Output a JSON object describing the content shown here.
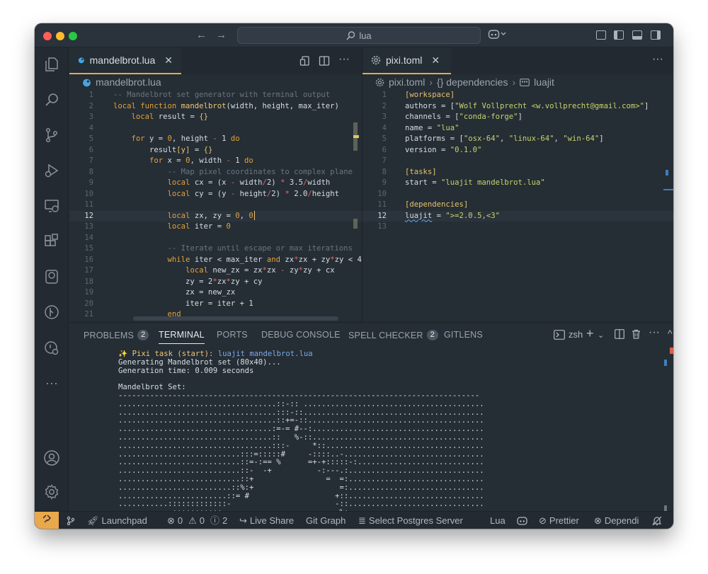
{
  "titlebar": {
    "search_text": "lua",
    "back_icon": "←",
    "forward_icon": "→"
  },
  "activity_bar": {
    "items": [
      "explorer-icon",
      "search-icon",
      "source-control-icon",
      "run-debug-icon",
      "remote-explorer-icon",
      "extensions-icon",
      "database-icon",
      "git-graph-icon",
      "timeline-icon",
      "more-icon"
    ],
    "bottom": [
      "account-icon",
      "settings-icon"
    ]
  },
  "editor_left": {
    "tab_label": "mandelbrot.lua",
    "breadcrumb": "mandelbrot.lua",
    "current_line": "12",
    "lines": [
      {
        "n": "1",
        "tokens": [
          [
            "c",
            "-- Mandelbrot set generator with terminal output"
          ]
        ]
      },
      {
        "n": "2",
        "tokens": [
          [
            "k",
            "local function "
          ],
          [
            "f",
            "mandelbrot"
          ],
          [
            "p",
            "(width, height, max_iter)"
          ]
        ]
      },
      {
        "n": "3",
        "tokens": [
          [
            "p",
            "    "
          ],
          [
            "k",
            "local "
          ],
          [
            "p",
            "result = "
          ],
          [
            "b",
            "{}"
          ]
        ]
      },
      {
        "n": "4",
        "tokens": []
      },
      {
        "n": "5",
        "tokens": [
          [
            "p",
            "    "
          ],
          [
            "k",
            "for "
          ],
          [
            "p",
            "y = "
          ],
          [
            "n",
            "0"
          ],
          [
            "p",
            ", height "
          ],
          [
            "o",
            "-"
          ],
          [
            "p",
            " 1 "
          ],
          [
            "k",
            "do"
          ]
        ]
      },
      {
        "n": "6",
        "tokens": [
          [
            "p",
            "        result"
          ],
          [
            "b",
            "[y]"
          ],
          [
            "p",
            " = "
          ],
          [
            "b",
            "{}"
          ]
        ]
      },
      {
        "n": "7",
        "tokens": [
          [
            "p",
            "        "
          ],
          [
            "k",
            "for "
          ],
          [
            "p",
            "x = "
          ],
          [
            "n",
            "0"
          ],
          [
            "p",
            ", width "
          ],
          [
            "o",
            "-"
          ],
          [
            "p",
            " 1 "
          ],
          [
            "k",
            "do"
          ]
        ]
      },
      {
        "n": "8",
        "tokens": [
          [
            "p",
            "            "
          ],
          [
            "c",
            "-- Map pixel coordinates to complex plane"
          ]
        ]
      },
      {
        "n": "9",
        "tokens": [
          [
            "p",
            "            "
          ],
          [
            "k",
            "local "
          ],
          [
            "p",
            "cx = (x "
          ],
          [
            "o",
            "-"
          ],
          [
            "p",
            " width"
          ],
          [
            "o",
            "/"
          ],
          [
            "p",
            "2) "
          ],
          [
            "o",
            "*"
          ],
          [
            "p",
            " 3.5"
          ],
          [
            "o",
            "/"
          ],
          [
            "p",
            "width"
          ]
        ]
      },
      {
        "n": "10",
        "tokens": [
          [
            "p",
            "            "
          ],
          [
            "k",
            "local "
          ],
          [
            "p",
            "cy = (y "
          ],
          [
            "o",
            "-"
          ],
          [
            "p",
            " height"
          ],
          [
            "o",
            "/"
          ],
          [
            "p",
            "2) "
          ],
          [
            "o",
            "*"
          ],
          [
            "p",
            " 2.0"
          ],
          [
            "o",
            "/"
          ],
          [
            "p",
            "height"
          ]
        ]
      },
      {
        "n": "11",
        "tokens": []
      },
      {
        "n": "12",
        "tokens": [
          [
            "p",
            "            "
          ],
          [
            "k",
            "local "
          ],
          [
            "p",
            "zx, zy = "
          ],
          [
            "n",
            "0"
          ],
          [
            "p",
            ", "
          ],
          [
            "n",
            "0"
          ]
        ]
      },
      {
        "n": "13",
        "tokens": [
          [
            "p",
            "            "
          ],
          [
            "k",
            "local "
          ],
          [
            "p",
            "iter = "
          ],
          [
            "n",
            "0"
          ]
        ]
      },
      {
        "n": "14",
        "tokens": []
      },
      {
        "n": "15",
        "tokens": [
          [
            "p",
            "            "
          ],
          [
            "c",
            "-- Iterate until escape or max iterations"
          ]
        ]
      },
      {
        "n": "16",
        "tokens": [
          [
            "p",
            "            "
          ],
          [
            "k",
            "while "
          ],
          [
            "p",
            "iter < max_iter "
          ],
          [
            "k",
            "and "
          ],
          [
            "p",
            "zx"
          ],
          [
            "o",
            "*"
          ],
          [
            "p",
            "zx + zy"
          ],
          [
            "o",
            "*"
          ],
          [
            "p",
            "zy < 4 "
          ],
          [
            "k",
            "d"
          ]
        ]
      },
      {
        "n": "17",
        "tokens": [
          [
            "p",
            "                "
          ],
          [
            "k",
            "local "
          ],
          [
            "p",
            "new_zx = zx"
          ],
          [
            "o",
            "*"
          ],
          [
            "p",
            "zx "
          ],
          [
            "o",
            "-"
          ],
          [
            "p",
            " zy"
          ],
          [
            "o",
            "*"
          ],
          [
            "p",
            "zy + cx"
          ]
        ]
      },
      {
        "n": "18",
        "tokens": [
          [
            "p",
            "                zy = 2"
          ],
          [
            "o",
            "*"
          ],
          [
            "p",
            "zx"
          ],
          [
            "o",
            "*"
          ],
          [
            "p",
            "zy + cy"
          ]
        ]
      },
      {
        "n": "19",
        "tokens": [
          [
            "p",
            "                zx = new_zx"
          ]
        ]
      },
      {
        "n": "20",
        "tokens": [
          [
            "p",
            "                iter = iter + 1"
          ]
        ]
      },
      {
        "n": "21",
        "tokens": [
          [
            "p",
            "            "
          ],
          [
            "k",
            "end"
          ]
        ]
      }
    ]
  },
  "editor_right": {
    "tab_label": "pixi.toml",
    "breadcrumb": [
      "pixi.toml",
      "{} dependencies",
      "luajit"
    ],
    "current_line": "12",
    "lines": [
      {
        "n": "1",
        "tokens": [
          [
            "t",
            "[workspace]"
          ]
        ]
      },
      {
        "n": "2",
        "tokens": [
          [
            "p",
            "authors = ["
          ],
          [
            "s",
            "\"Wolf Vollprecht <w.vollprecht@gmail.com>\""
          ],
          [
            "p",
            "]"
          ]
        ]
      },
      {
        "n": "3",
        "tokens": [
          [
            "p",
            "channels = ["
          ],
          [
            "s",
            "\"conda-forge\""
          ],
          [
            "p",
            "]"
          ]
        ]
      },
      {
        "n": "4",
        "tokens": [
          [
            "p",
            "name = "
          ],
          [
            "s",
            "\"lua\""
          ]
        ]
      },
      {
        "n": "5",
        "tokens": [
          [
            "p",
            "platforms = ["
          ],
          [
            "s",
            "\"osx-64\""
          ],
          [
            "p",
            ", "
          ],
          [
            "s",
            "\"linux-64\""
          ],
          [
            "p",
            ", "
          ],
          [
            "s",
            "\"win-64\""
          ],
          [
            "p",
            "]"
          ]
        ]
      },
      {
        "n": "6",
        "tokens": [
          [
            "p",
            "version = "
          ],
          [
            "s",
            "\"0.1.0\""
          ]
        ]
      },
      {
        "n": "7",
        "tokens": []
      },
      {
        "n": "8",
        "tokens": [
          [
            "t",
            "[tasks]"
          ]
        ]
      },
      {
        "n": "9",
        "tokens": [
          [
            "p",
            "start = "
          ],
          [
            "s",
            "\"luajit mandelbrot.lua\""
          ]
        ]
      },
      {
        "n": "10",
        "tokens": []
      },
      {
        "n": "11",
        "tokens": [
          [
            "t",
            "[dependencies]"
          ]
        ]
      },
      {
        "n": "12",
        "tokens": [
          [
            "u",
            "luajit"
          ],
          [
            "p",
            " = "
          ],
          [
            "s",
            "\">=2.0.5,<3\""
          ]
        ]
      },
      {
        "n": "13",
        "tokens": []
      }
    ]
  },
  "panel": {
    "tabs": [
      {
        "label": "PROBLEMS",
        "badge": "2"
      },
      {
        "label": "TERMINAL",
        "badge": ""
      },
      {
        "label": "PORTS",
        "badge": ""
      },
      {
        "label": "DEBUG CONSOLE",
        "badge": ""
      },
      {
        "label": "SPELL CHECKER",
        "badge": "2"
      },
      {
        "label": "GITLENS",
        "badge": ""
      }
    ],
    "shell_label": "zsh",
    "terminal": {
      "task_prefix": "✨ Pixi task (start): ",
      "task_cmd": "luajit mandelbrot.lua",
      "lines": [
        "Generating Mandelbrot set (80x40)...",
        "Generation time: 0.009 seconds",
        "",
        "Mandelbrot Set:",
        "--------------------------------------------------------------------------------",
        "...................................::-:: ........................................",
        "...................................:::-::........................................",
        "...................................::+=-::.......................................",
        "..................................:=-= #--:......................................",
        "..................................::   %-::......................................",
        "..................................:::-     *::...................................",
        "...........................:::=:::::#     -::::..-...............................",
        "...........................::=-:== %      =+-+:::::-:............................",
        "...........................::-  -+          -:---.:..............................",
        "...........................::+                =  =:..............................",
        ".........................::%:+                   =:..............................",
        "........................::= #                   +::..............................",
        "...........:::::::::::::-                       -::..............................",
        "...........-:::::::::::                          %:..............................."
      ]
    }
  },
  "statusbar": {
    "items": [
      "Launchpad",
      "0",
      "0",
      "2",
      "Live Share",
      "Git Graph",
      "Select Postgres Server",
      "Lua",
      "Prettier",
      "Dependi"
    ]
  }
}
